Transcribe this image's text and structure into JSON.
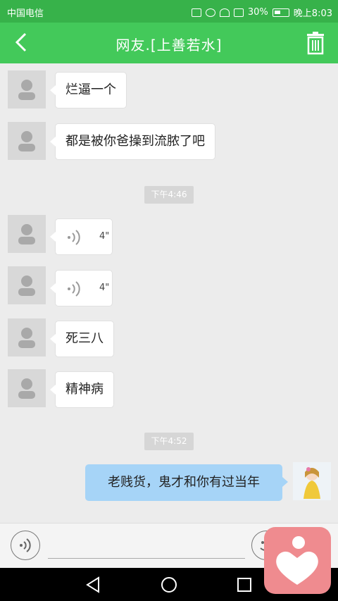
{
  "status_bar": {
    "carrier": "中国电信",
    "battery": "30%",
    "time": "晚上8:03"
  },
  "header": {
    "title": "网友.[上善若水]",
    "back_icon": "chevron-left-icon",
    "delete_icon": "trash-icon"
  },
  "messages": [
    {
      "type": "text",
      "from": "other",
      "text": "烂逼一个"
    },
    {
      "type": "text",
      "from": "other",
      "text": "都是被你爸操到流脓了吧"
    },
    {
      "type": "time",
      "text": "下午4:46"
    },
    {
      "type": "voice",
      "from": "other",
      "duration": "4\""
    },
    {
      "type": "voice",
      "from": "other",
      "duration": "4\""
    },
    {
      "type": "text",
      "from": "other",
      "text": "死三八"
    },
    {
      "type": "text",
      "from": "other",
      "text": "精神病"
    },
    {
      "type": "time",
      "text": "下午4:52"
    },
    {
      "type": "text",
      "from": "me",
      "text": "老贱货，鬼才和你有过当年"
    }
  ],
  "input_bar": {
    "voice_icon": "voice-toggle-icon",
    "emoji_icon": "emoji-icon"
  },
  "nav": [
    "back-icon",
    "home-icon",
    "recents-icon"
  ],
  "colors": {
    "header": "#43c95a",
    "status": "#37b24a",
    "my_bubble": "#a6d4f7",
    "floating": "#ef8b8f"
  }
}
